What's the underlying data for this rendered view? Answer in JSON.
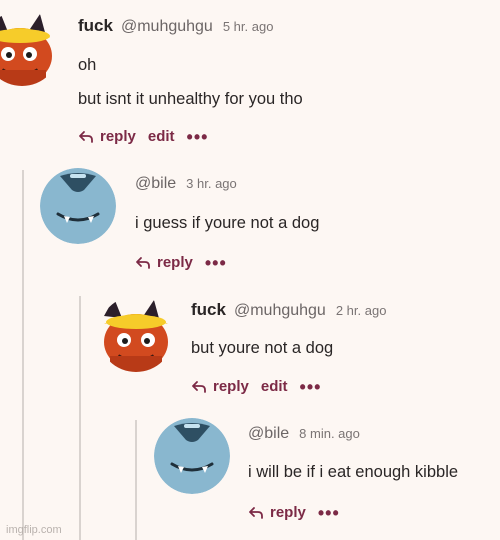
{
  "comments": [
    {
      "display_name": "fuck",
      "handle": "@muhguhgu",
      "time": "5 hr. ago",
      "lines": [
        "oh",
        "but isnt it unhealthy for you tho"
      ],
      "reply_label": "reply",
      "edit_label": "edit",
      "more_label": "•••",
      "avatar_icon": "fox-avatar-icon"
    },
    {
      "display_name": "",
      "handle": "@bile",
      "time": "3 hr. ago",
      "lines": [
        "i guess if youre not a dog"
      ],
      "reply_label": "reply",
      "more_label": "•••",
      "avatar_icon": "blue-creature-avatar-icon"
    },
    {
      "display_name": "fuck",
      "handle": "@muhguhgu",
      "time": "2 hr. ago",
      "lines": [
        "but youre not a dog"
      ],
      "reply_label": "reply",
      "edit_label": "edit",
      "more_label": "•••",
      "avatar_icon": "fox-avatar-icon"
    },
    {
      "display_name": "",
      "handle": "@bile",
      "time": "8 min. ago",
      "lines": [
        "i will be if i eat enough kibble"
      ],
      "reply_label": "reply",
      "more_label": "•••",
      "avatar_icon": "blue-creature-avatar-icon"
    }
  ],
  "watermark": "imgflip.com",
  "colors": {
    "accent": "#7c2a46",
    "background": "#fdf7f3",
    "thread_line": "#d9d3cf"
  }
}
